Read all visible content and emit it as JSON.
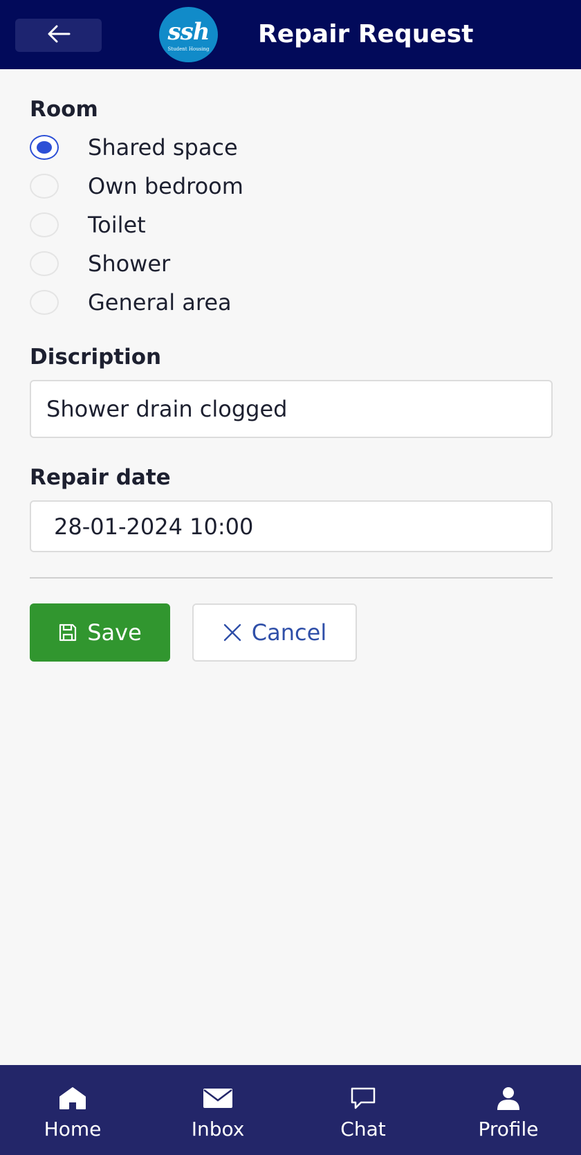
{
  "header": {
    "title": "Repair Request",
    "logo_mark": "ssh",
    "logo_sub": "Student Housing"
  },
  "room": {
    "label": "Room",
    "options": [
      {
        "label": "Shared space",
        "checked": true
      },
      {
        "label": "Own bedroom",
        "checked": false
      },
      {
        "label": "Toilet",
        "checked": false
      },
      {
        "label": "Shower",
        "checked": false
      },
      {
        "label": "General area",
        "checked": false
      }
    ]
  },
  "description": {
    "label": "Discription",
    "value": "Shower drain clogged"
  },
  "repair_date": {
    "label": "Repair date",
    "value": "28-01-2024 10:00"
  },
  "actions": {
    "save_label": "Save",
    "cancel_label": "Cancel"
  },
  "bottom_nav": [
    {
      "label": "Home",
      "icon": "home-icon"
    },
    {
      "label": "Inbox",
      "icon": "inbox-icon"
    },
    {
      "label": "Chat",
      "icon": "chat-icon"
    },
    {
      "label": "Profile",
      "icon": "profile-icon"
    }
  ],
  "colors": {
    "header_bg": "#020a5a",
    "nav_bg": "#232669",
    "accent": "#2c4fd6",
    "save_bg": "#31962f",
    "cancel_text": "#2f4fa8",
    "logo_bg": "#118bc9"
  }
}
